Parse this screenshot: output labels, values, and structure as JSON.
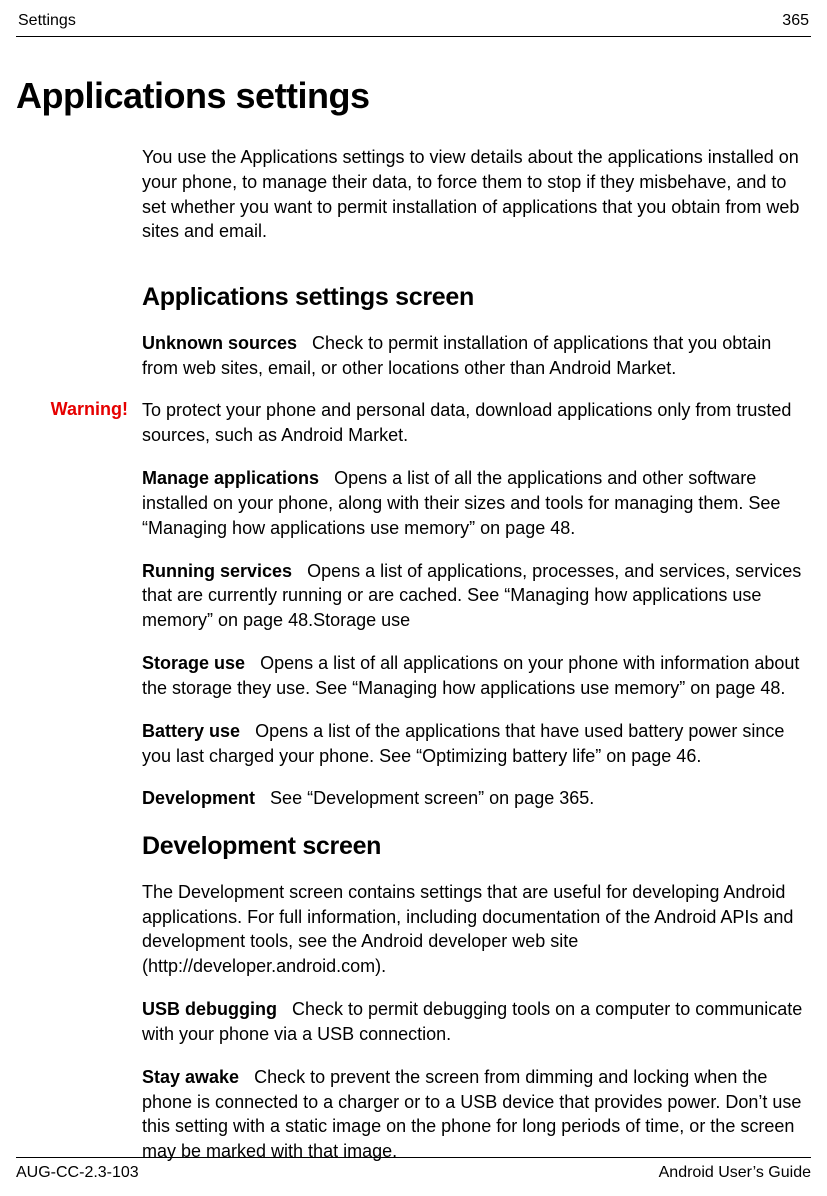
{
  "header": {
    "left": "Settings",
    "right": "365"
  },
  "title": "Applications settings",
  "intro": "You use the Applications settings to view details about the applications installed on your phone, to manage their data, to force them to stop if they misbehave, and to set whether you want to permit installation of applications that you obtain from web sites and email.",
  "section1": {
    "heading": "Applications settings screen",
    "unknown_sources": {
      "label": "Unknown sources",
      "text": "Check to permit installation of applications that you obtain from web sites, email, or other locations other than Android Market."
    },
    "warning_label": "Warning!",
    "warning_text": "To protect your phone and personal data, download applications only from trusted sources, such as Android Market.",
    "manage_apps": {
      "label": "Manage applications",
      "text": "Opens a list of all the applications and other software installed on your phone, along with their sizes and tools for managing them. See “Managing how applications use memory” on page 48."
    },
    "running_services": {
      "label": "Running services",
      "text": "Opens a list of applications, processes, and services, services that are currently running or are cached. See “Managing how applications use memory” on page 48.Storage use"
    },
    "storage_use": {
      "label": "Storage use",
      "text": "Opens a list of all applications on your phone with information about the storage they use. See “Managing how applications use memory” on page 48."
    },
    "battery_use": {
      "label": "Battery use",
      "text": "Opens a list of the applications that have used battery power since you last charged your phone. See “Optimizing battery life” on page 46."
    },
    "development": {
      "label": "Development",
      "text": "See “Development screen” on page 365."
    }
  },
  "section2": {
    "heading": "Development screen",
    "intro": "The Development screen contains settings that are useful for developing Android applications. For full information, including documentation of the Android APIs and development tools, see the Android developer web site (http://developer.android.com).",
    "usb_debugging": {
      "label": "USB debugging",
      "text": "Check to permit debugging tools on a computer to communicate with your phone via a USB connection."
    },
    "stay_awake": {
      "label": "Stay awake",
      "text": "Check to prevent the screen from dimming and locking when the phone is connected to a charger or to a USB device that provides power. Don’t use this setting with a static image on the phone for long periods of time, or the screen may be marked with that image."
    }
  },
  "footer": {
    "left": "AUG-CC-2.3-103",
    "right": "Android User’s Guide"
  }
}
